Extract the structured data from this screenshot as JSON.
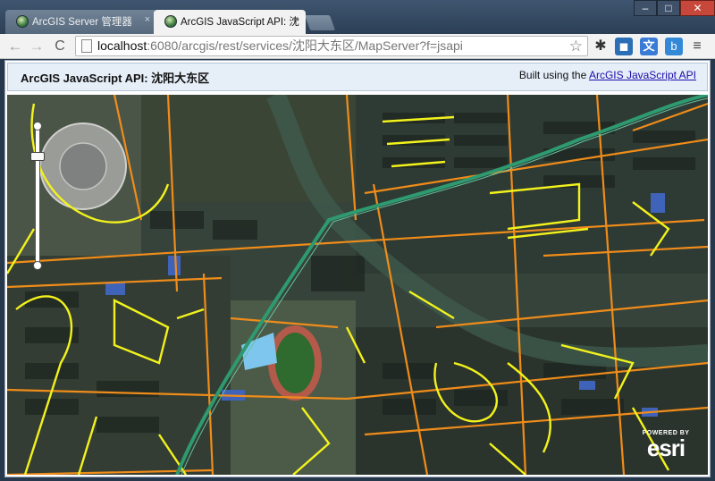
{
  "browser": {
    "tabs": [
      {
        "title": "ArcGIS Server 管理器",
        "close": "×"
      },
      {
        "title": "ArcGIS JavaScript API: 沈",
        "close": "×"
      }
    ],
    "window_controls": {
      "minimize": "–",
      "maximize": "□",
      "close": "✕"
    },
    "nav": {
      "back": "←",
      "forward": "→",
      "reload": "C"
    },
    "address": {
      "host": "localhost",
      "rest": ":6080/arcgis/rest/services/沈阳大东区/MapServer?f=jsapi"
    },
    "extensions": {
      "gear": "✱",
      "toolbox": "◼",
      "translate": "文",
      "baidu": "b",
      "menu": "≡"
    }
  },
  "page": {
    "title": "ArcGIS JavaScript API: 沈阳大东区",
    "built_using_prefix": "Built using the ",
    "built_using_link": "ArcGIS JavaScript API"
  },
  "map": {
    "logo_powered": "POWERED BY",
    "logo_brand": "esri",
    "colors": {
      "road_orange": "#f08c1a",
      "road_yellow": "#f2f21c",
      "rail_green": "#2e9a70",
      "imagery_dark": "#2d3a2c"
    }
  }
}
